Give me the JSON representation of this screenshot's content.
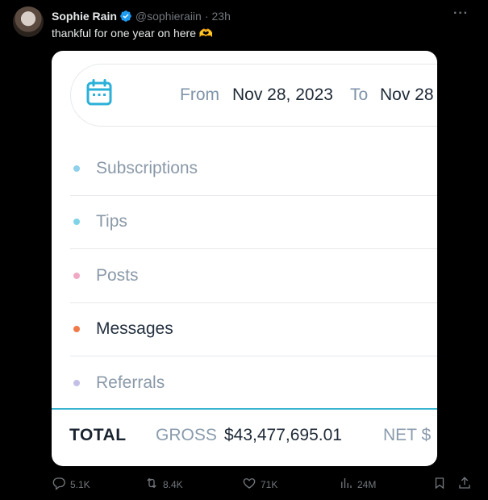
{
  "post": {
    "author_name": "Sophie Rain",
    "handle": "@sophieraiin",
    "separator": "·",
    "time": "23h",
    "more_label": "···",
    "text": "thankful for one year on here 🫶",
    "verified": true,
    "verified_color": "#1d9bf0"
  },
  "card": {
    "date_range": {
      "from_label": "From",
      "from_date": "Nov 28, 2023",
      "to_label": "To",
      "to_date": "Nov 28"
    },
    "categories": [
      {
        "label": "Subscriptions",
        "color": "#8fd1ea",
        "active": false
      },
      {
        "label": "Tips",
        "color": "#7fd3e6",
        "active": false
      },
      {
        "label": "Posts",
        "color": "#f0a9c4",
        "active": false
      },
      {
        "label": "Messages",
        "color": "#f07a4a",
        "active": true
      },
      {
        "label": "Referrals",
        "color": "#c3bfe6",
        "active": false
      }
    ],
    "totals": {
      "total_label": "TOTAL",
      "gross_label": "GROSS",
      "gross_value": "$43,477,695.01",
      "net_label": "NET $"
    },
    "accent_color": "#3ab3cf"
  },
  "actions": {
    "replies": "5.1K",
    "reposts": "8.4K",
    "likes": "71K",
    "views": "24M"
  }
}
